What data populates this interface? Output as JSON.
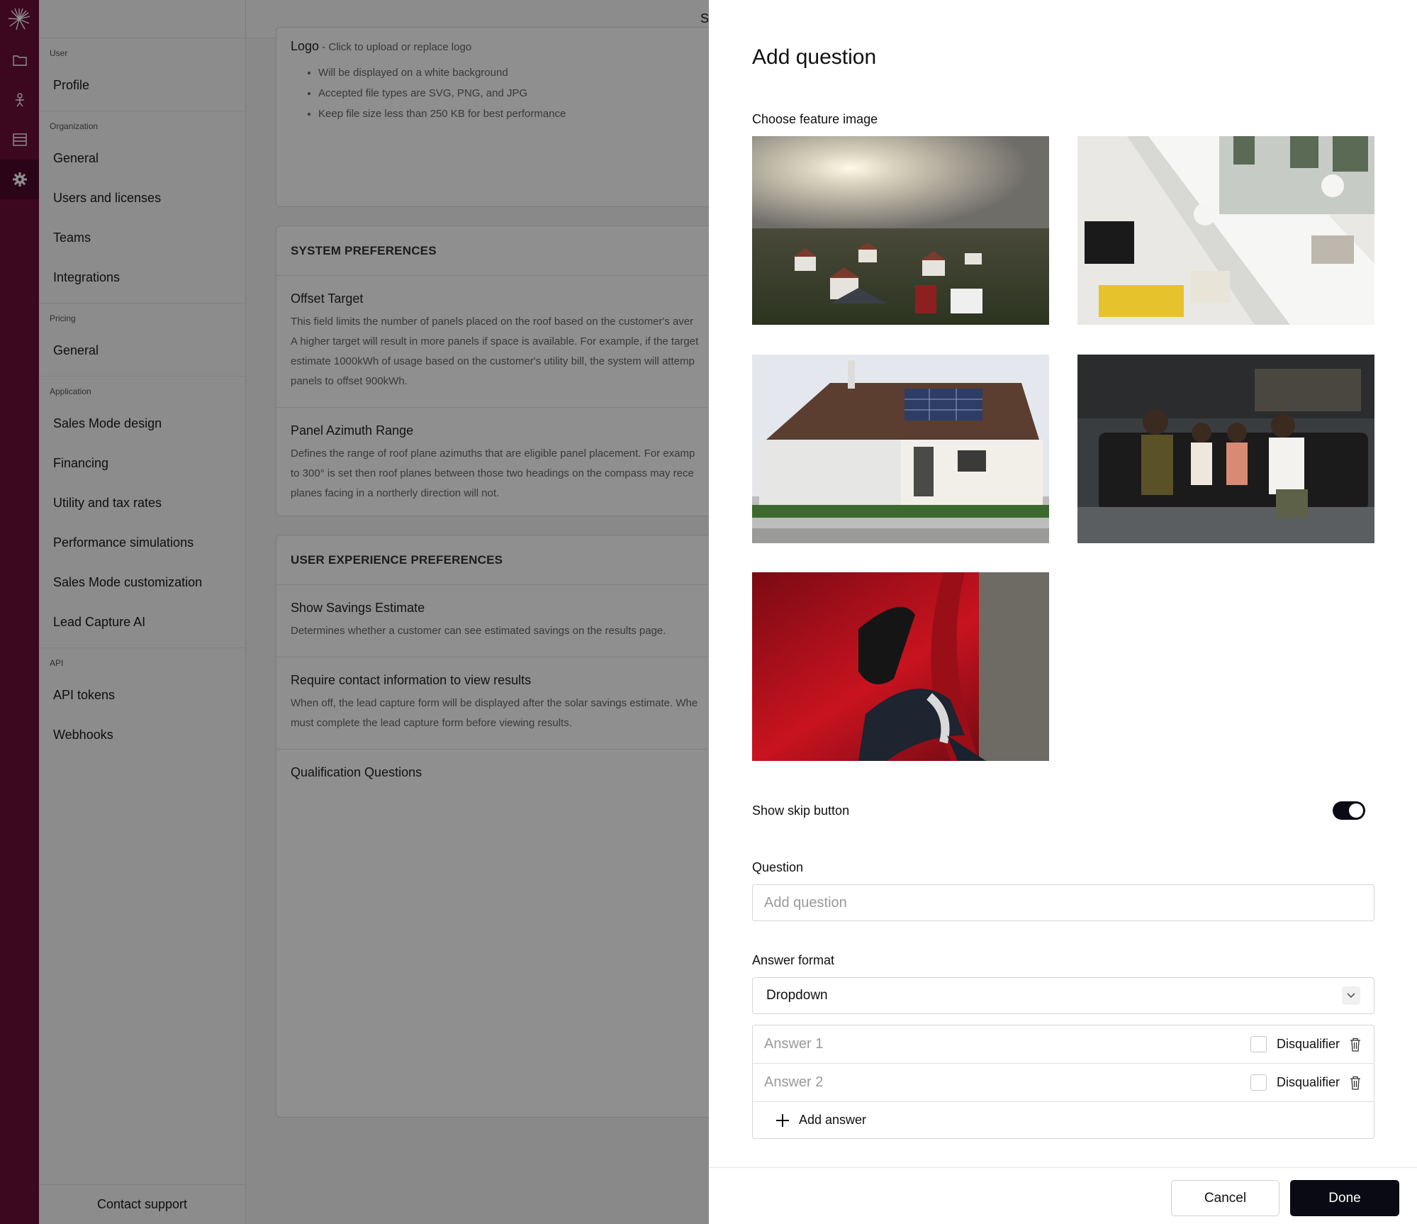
{
  "sidebar": {
    "groups": [
      {
        "label": "User",
        "items": [
          "Profile"
        ]
      },
      {
        "label": "Organization",
        "items": [
          "General",
          "Users and licenses",
          "Teams",
          "Integrations"
        ]
      },
      {
        "label": "Pricing",
        "items": [
          "General"
        ]
      },
      {
        "label": "Application",
        "items": [
          "Sales Mode design",
          "Financing",
          "Utility and tax rates",
          "Performance simulations",
          "Sales Mode customization",
          "Lead Capture AI"
        ]
      },
      {
        "label": "API",
        "items": [
          "API tokens",
          "Webhooks"
        ]
      }
    ],
    "footer": "Contact support"
  },
  "main": {
    "header_fragment": "S",
    "logo": {
      "title": "Logo",
      "hint": " - Click to upload or replace logo",
      "bullets": [
        "Will be displayed on a white background",
        "Accepted file types are SVG, PNG, and JPG",
        "Keep file size less than 250 KB for best performance"
      ]
    },
    "system_preferences": {
      "header": "SYSTEM PREFERENCES",
      "offset_title": "Offset Target",
      "offset_desc": [
        "This field limits the number of panels placed on the roof based on the customer's aver",
        "A higher target will result in more panels if space is available. For example, if the target",
        "estimate 1000kWh of usage based on the customer's utility bill, the system will attemp",
        "panels to offset 900kWh."
      ],
      "azimuth_title": "Panel Azimuth Range",
      "azimuth_desc": [
        "Defines the range of roof plane azimuths that are eligible panel placement. For examp",
        "to 300° is set then roof planes between those two headings on the compass may rece",
        "planes facing in a northerly direction will not."
      ]
    },
    "ux_preferences": {
      "header": "USER EXPERIENCE PREFERENCES",
      "savings_title": "Show Savings Estimate",
      "savings_desc": "Determines whether a customer can see estimated savings on the results page.",
      "contact_title": "Require contact information to view results",
      "contact_desc": [
        "When off, the lead capture form will be displayed after the solar savings estimate. Whe",
        "must complete the lead capture form before viewing results."
      ],
      "qualification_title": "Qualification Questions"
    }
  },
  "drawer": {
    "title": "Add question",
    "image_label": "Choose feature image",
    "skip_label": "Show skip button",
    "skip_on": true,
    "question_label": "Question",
    "question_placeholder": "Add question",
    "question_value": "",
    "answer_format_label": "Answer format",
    "answer_format_value": "Dropdown",
    "answers": [
      {
        "placeholder": "Answer 1",
        "disqualifier_label": "Disqualifier",
        "checked": false
      },
      {
        "placeholder": "Answer 2",
        "disqualifier_label": "Disqualifier",
        "checked": false
      }
    ],
    "add_answer_label": "Add answer",
    "cancel_label": "Cancel",
    "done_label": "Done"
  },
  "colors": {
    "rail": "#6b0f3a",
    "primary_button": "#0a0a14"
  },
  "icons": {
    "rail": [
      "brand-logo-icon",
      "folder-icon",
      "person-icon",
      "list-icon",
      "gear-icon"
    ]
  }
}
